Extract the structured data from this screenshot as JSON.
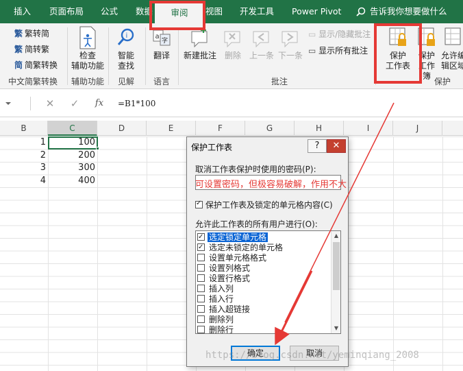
{
  "tabs": [
    {
      "label": "插入"
    },
    {
      "label": "页面布局"
    },
    {
      "label": "公式"
    },
    {
      "label": "数据"
    },
    {
      "label": "审阅"
    },
    {
      "label": "视图"
    },
    {
      "label": "开发工具"
    },
    {
      "label": "Power Pivot"
    }
  ],
  "tell_me": "告诉我你想要做什么",
  "ribbon": {
    "chinese_group": {
      "items": [
        "繁转简",
        "简转繁",
        "简繁转换"
      ],
      "label": "中文简繁转换"
    },
    "accessibility": {
      "button": "检查\n辅助功能",
      "label": "辅助功能"
    },
    "insights": {
      "button": "智能\n查找",
      "label": "见解"
    },
    "language": {
      "button": "翻译",
      "label": "语言"
    },
    "comments": {
      "new": "新建批注",
      "delete": "删除",
      "prev": "上一条",
      "next": "下一条",
      "show_hide": "显示/隐藏批注",
      "show_all": "显示所有批注",
      "label": "批注"
    },
    "protect": {
      "sheet": "保护\n工作表",
      "workbook": "保护\n工作簿",
      "allow_edit": "允许编\n辑区域",
      "label": "保护"
    }
  },
  "formula_bar": {
    "cancel": "✕",
    "enter": "✓",
    "fx": "fx",
    "formula": "=B1*100"
  },
  "columns": [
    "B",
    "C",
    "D",
    "E",
    "F",
    "G",
    "H",
    "I",
    "J"
  ],
  "rows": [
    {
      "b": "1",
      "c": "100"
    },
    {
      "b": "2",
      "c": "200"
    },
    {
      "b": "3",
      "c": "300"
    },
    {
      "b": "4",
      "c": "400"
    }
  ],
  "dialog": {
    "title": "保护工作表",
    "help": "?",
    "close": "✕",
    "password_label": "取消工作表保护时使用的密码(P):",
    "annotation": "可设置密码，但极容易破解，作用不大",
    "protect_label": "保护工作表及锁定的单元格内容(C)",
    "allow_label": "允许此工作表的所有用户进行(O):",
    "permissions": [
      {
        "label": "选定锁定单元格",
        "checked": true,
        "selected": true
      },
      {
        "label": "选定未锁定的单元格",
        "checked": true,
        "selected": false
      },
      {
        "label": "设置单元格格式",
        "checked": false,
        "selected": false
      },
      {
        "label": "设置列格式",
        "checked": false,
        "selected": false
      },
      {
        "label": "设置行格式",
        "checked": false,
        "selected": false
      },
      {
        "label": "插入列",
        "checked": false,
        "selected": false
      },
      {
        "label": "插入行",
        "checked": false,
        "selected": false
      },
      {
        "label": "插入超链接",
        "checked": false,
        "selected": false
      },
      {
        "label": "删除列",
        "checked": false,
        "selected": false
      },
      {
        "label": "删除行",
        "checked": false,
        "selected": false
      }
    ],
    "ok": "确定",
    "cancel": "取消"
  },
  "watermark": "https://blog.csdn.net/yeminqiang_2008",
  "colors": {
    "excel_green": "#217346",
    "annotation_red": "#e53935",
    "selection_blue": "#0a64d4"
  }
}
